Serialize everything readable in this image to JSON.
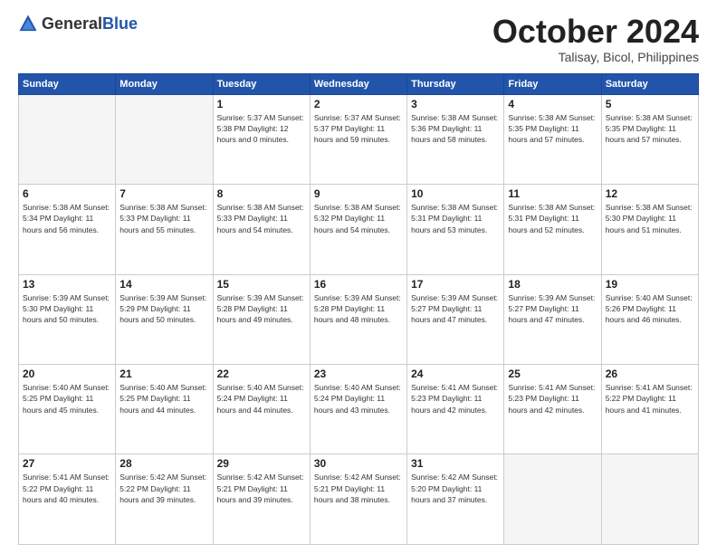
{
  "header": {
    "logo_general": "General",
    "logo_blue": "Blue",
    "month": "October 2024",
    "location": "Talisay, Bicol, Philippines"
  },
  "weekdays": [
    "Sunday",
    "Monday",
    "Tuesday",
    "Wednesday",
    "Thursday",
    "Friday",
    "Saturday"
  ],
  "weeks": [
    [
      {
        "day": "",
        "empty": true
      },
      {
        "day": "",
        "empty": true
      },
      {
        "day": "1",
        "info": "Sunrise: 5:37 AM\nSunset: 5:38 PM\nDaylight: 12 hours\nand 0 minutes."
      },
      {
        "day": "2",
        "info": "Sunrise: 5:37 AM\nSunset: 5:37 PM\nDaylight: 11 hours\nand 59 minutes."
      },
      {
        "day": "3",
        "info": "Sunrise: 5:38 AM\nSunset: 5:36 PM\nDaylight: 11 hours\nand 58 minutes."
      },
      {
        "day": "4",
        "info": "Sunrise: 5:38 AM\nSunset: 5:35 PM\nDaylight: 11 hours\nand 57 minutes."
      },
      {
        "day": "5",
        "info": "Sunrise: 5:38 AM\nSunset: 5:35 PM\nDaylight: 11 hours\nand 57 minutes."
      }
    ],
    [
      {
        "day": "6",
        "info": "Sunrise: 5:38 AM\nSunset: 5:34 PM\nDaylight: 11 hours\nand 56 minutes."
      },
      {
        "day": "7",
        "info": "Sunrise: 5:38 AM\nSunset: 5:33 PM\nDaylight: 11 hours\nand 55 minutes."
      },
      {
        "day": "8",
        "info": "Sunrise: 5:38 AM\nSunset: 5:33 PM\nDaylight: 11 hours\nand 54 minutes."
      },
      {
        "day": "9",
        "info": "Sunrise: 5:38 AM\nSunset: 5:32 PM\nDaylight: 11 hours\nand 54 minutes."
      },
      {
        "day": "10",
        "info": "Sunrise: 5:38 AM\nSunset: 5:31 PM\nDaylight: 11 hours\nand 53 minutes."
      },
      {
        "day": "11",
        "info": "Sunrise: 5:38 AM\nSunset: 5:31 PM\nDaylight: 11 hours\nand 52 minutes."
      },
      {
        "day": "12",
        "info": "Sunrise: 5:38 AM\nSunset: 5:30 PM\nDaylight: 11 hours\nand 51 minutes."
      }
    ],
    [
      {
        "day": "13",
        "info": "Sunrise: 5:39 AM\nSunset: 5:30 PM\nDaylight: 11 hours\nand 50 minutes."
      },
      {
        "day": "14",
        "info": "Sunrise: 5:39 AM\nSunset: 5:29 PM\nDaylight: 11 hours\nand 50 minutes."
      },
      {
        "day": "15",
        "info": "Sunrise: 5:39 AM\nSunset: 5:28 PM\nDaylight: 11 hours\nand 49 minutes."
      },
      {
        "day": "16",
        "info": "Sunrise: 5:39 AM\nSunset: 5:28 PM\nDaylight: 11 hours\nand 48 minutes."
      },
      {
        "day": "17",
        "info": "Sunrise: 5:39 AM\nSunset: 5:27 PM\nDaylight: 11 hours\nand 47 minutes."
      },
      {
        "day": "18",
        "info": "Sunrise: 5:39 AM\nSunset: 5:27 PM\nDaylight: 11 hours\nand 47 minutes."
      },
      {
        "day": "19",
        "info": "Sunrise: 5:40 AM\nSunset: 5:26 PM\nDaylight: 11 hours\nand 46 minutes."
      }
    ],
    [
      {
        "day": "20",
        "info": "Sunrise: 5:40 AM\nSunset: 5:25 PM\nDaylight: 11 hours\nand 45 minutes."
      },
      {
        "day": "21",
        "info": "Sunrise: 5:40 AM\nSunset: 5:25 PM\nDaylight: 11 hours\nand 44 minutes."
      },
      {
        "day": "22",
        "info": "Sunrise: 5:40 AM\nSunset: 5:24 PM\nDaylight: 11 hours\nand 44 minutes."
      },
      {
        "day": "23",
        "info": "Sunrise: 5:40 AM\nSunset: 5:24 PM\nDaylight: 11 hours\nand 43 minutes."
      },
      {
        "day": "24",
        "info": "Sunrise: 5:41 AM\nSunset: 5:23 PM\nDaylight: 11 hours\nand 42 minutes."
      },
      {
        "day": "25",
        "info": "Sunrise: 5:41 AM\nSunset: 5:23 PM\nDaylight: 11 hours\nand 42 minutes."
      },
      {
        "day": "26",
        "info": "Sunrise: 5:41 AM\nSunset: 5:22 PM\nDaylight: 11 hours\nand 41 minutes."
      }
    ],
    [
      {
        "day": "27",
        "info": "Sunrise: 5:41 AM\nSunset: 5:22 PM\nDaylight: 11 hours\nand 40 minutes."
      },
      {
        "day": "28",
        "info": "Sunrise: 5:42 AM\nSunset: 5:22 PM\nDaylight: 11 hours\nand 39 minutes."
      },
      {
        "day": "29",
        "info": "Sunrise: 5:42 AM\nSunset: 5:21 PM\nDaylight: 11 hours\nand 39 minutes."
      },
      {
        "day": "30",
        "info": "Sunrise: 5:42 AM\nSunset: 5:21 PM\nDaylight: 11 hours\nand 38 minutes."
      },
      {
        "day": "31",
        "info": "Sunrise: 5:42 AM\nSunset: 5:20 PM\nDaylight: 11 hours\nand 37 minutes."
      },
      {
        "day": "",
        "empty": true
      },
      {
        "day": "",
        "empty": true
      }
    ]
  ]
}
